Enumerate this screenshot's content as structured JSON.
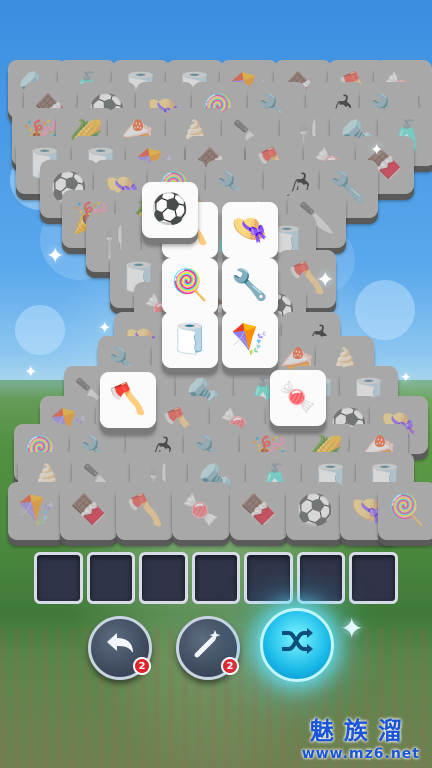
{
  "game": {
    "tile_items": [
      "bolt",
      "bottle",
      "tape",
      "duct-tape",
      "pinwheel",
      "popsicle",
      "axe",
      "candy",
      "chocolate",
      "beach-ball",
      "hat",
      "candy-cane",
      "pliers",
      "chili",
      "wrench",
      "party-hat",
      "corn",
      "cake",
      "ice-cream",
      "knife",
      "fork"
    ],
    "tray_slots": 7,
    "tray_slots_filled": 0,
    "controls": {
      "undo": {
        "icon": "undo-arrow-icon",
        "count": "2"
      },
      "magic": {
        "icon": "magic-wand-icon",
        "count": "2"
      },
      "shuffle": {
        "icon": "shuffle-icon"
      }
    }
  },
  "watermark": {
    "title": "魅族溜",
    "url": "www.mz6.net"
  },
  "colors": {
    "tray": "#2f3448",
    "shuffle_glow": "#18b9e8",
    "badge": "#e0242c",
    "watermark": "#1a55d8"
  }
}
